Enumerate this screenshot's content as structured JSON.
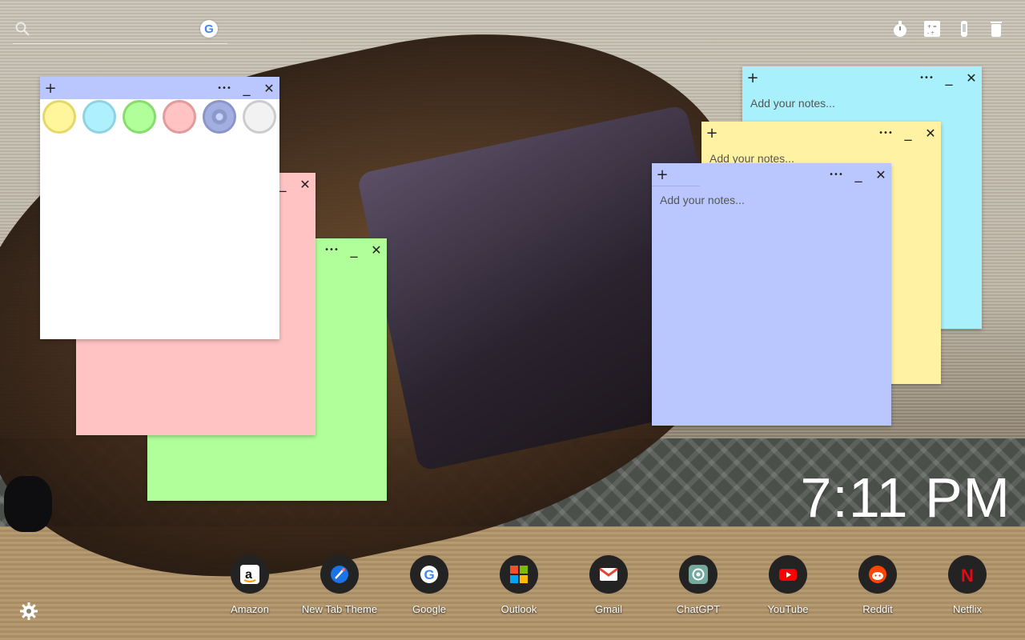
{
  "search": {
    "placeholder": "",
    "engine_icon": "google-g-icon",
    "engine_letter": "G"
  },
  "toolbar": {
    "icons": [
      "timer-icon",
      "calculator-icon",
      "eyedropper-icon",
      "trash-icon"
    ]
  },
  "notes": [
    {
      "id": "note-blue",
      "color": "#a8f0fb",
      "placeholder": "Add your notes..."
    },
    {
      "id": "note-yellow",
      "color": "#fff3a3",
      "placeholder": "Add your notes..."
    },
    {
      "id": "note-periwinkle",
      "color": "#b9c7fe",
      "placeholder": "Add your notes..."
    },
    {
      "id": "note-pink",
      "color": "#ffc3c4",
      "placeholder": ""
    },
    {
      "id": "note-green",
      "color": "#b1ff9a",
      "placeholder": ""
    },
    {
      "id": "note-picker",
      "color": "#ffffff",
      "header_color": "#b9c7fe",
      "placeholder": ""
    }
  ],
  "note_controls": {
    "add": "+",
    "more": "•••",
    "minimize": "_",
    "close": "✕"
  },
  "color_swatches": [
    {
      "name": "yellow",
      "fill": "#fff59a",
      "ring": "#e6d76a"
    },
    {
      "name": "blue",
      "fill": "#aef0fb",
      "ring": "#8dd3e2"
    },
    {
      "name": "green",
      "fill": "#b1ff9a",
      "ring": "#86dc6c"
    },
    {
      "name": "pink",
      "fill": "#ffc3c4",
      "ring": "#e29a9b"
    },
    {
      "name": "periwinkle",
      "fill": "#b9c7fe",
      "ring": "#8a95c9",
      "selected": true
    },
    {
      "name": "white",
      "fill": "#f2f2f2",
      "ring": "#cccccc"
    }
  ],
  "clock": {
    "time": "7:11 PM"
  },
  "shortcuts": [
    {
      "label": "Amazon",
      "icon": "amazon-icon"
    },
    {
      "label": "New Tab Theme",
      "icon": "new-tab-theme-icon"
    },
    {
      "label": "Google",
      "icon": "google-icon"
    },
    {
      "label": "Outlook",
      "icon": "outlook-icon"
    },
    {
      "label": "Gmail",
      "icon": "gmail-icon"
    },
    {
      "label": "ChatGPT",
      "icon": "chatgpt-icon"
    },
    {
      "label": "YouTube",
      "icon": "youtube-icon"
    },
    {
      "label": "Reddit",
      "icon": "reddit-icon"
    },
    {
      "label": "Netflix",
      "icon": "netflix-icon"
    }
  ],
  "settings": {
    "icon": "gear-icon"
  }
}
